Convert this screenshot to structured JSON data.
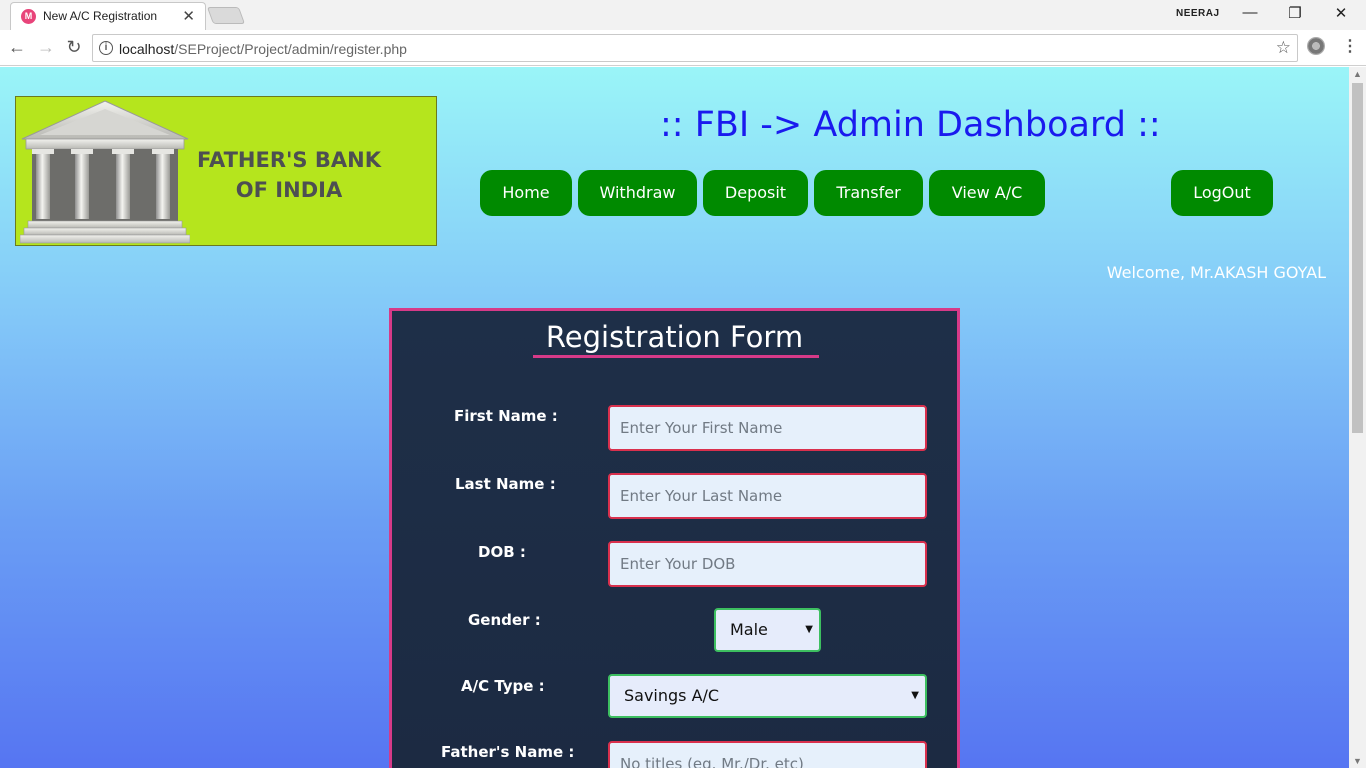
{
  "browser": {
    "tab_title": "New A/C Registration",
    "tab_favicon": "M",
    "tab_close": "✕",
    "profile_name": "NEERAJ",
    "url_host": "localhost",
    "url_path": "/SEProject/Project/admin/register.php",
    "icons": [
      "back-arrow-icon",
      "forward-arrow-icon",
      "reload-icon",
      "info-icon",
      "star-icon",
      "extension-icon",
      "menu-icon"
    ]
  },
  "header": {
    "logo_line1": "FATHER'S BANK",
    "logo_line2": "OF INDIA",
    "dashboard_title": ":: FBI -> Admin Dashboard ::",
    "nav": {
      "home": "Home",
      "withdraw": "Withdraw",
      "deposit": "Deposit",
      "transfer": "Transfer",
      "view_ac": "View A/C",
      "logout": "LogOut"
    },
    "welcome": "Welcome, Mr.AKASH GOYAL"
  },
  "form": {
    "title": "Registration Form",
    "first_name": {
      "label": "First Name :",
      "placeholder": "Enter Your First Name"
    },
    "last_name": {
      "label": "Last Name :",
      "placeholder": "Enter Your Last Name"
    },
    "dob": {
      "label": "DOB :",
      "placeholder": "Enter Your DOB"
    },
    "gender": {
      "label": "Gender :",
      "selected": "Male"
    },
    "ac_type": {
      "label": "A/C Type :",
      "selected": "Savings A/C"
    },
    "father_name": {
      "label": "Father's Name :",
      "placeholder": "No titles (eg. Mr./Dr. etc)"
    }
  },
  "colors": {
    "nav_button": "#008a00",
    "form_border": "#d63a88",
    "form_background": "#1e2f48",
    "title_blue": "#1a1aee",
    "logo_background": "#b5e51d",
    "input_border": "#d9304d",
    "select_border": "#3dbf60"
  }
}
